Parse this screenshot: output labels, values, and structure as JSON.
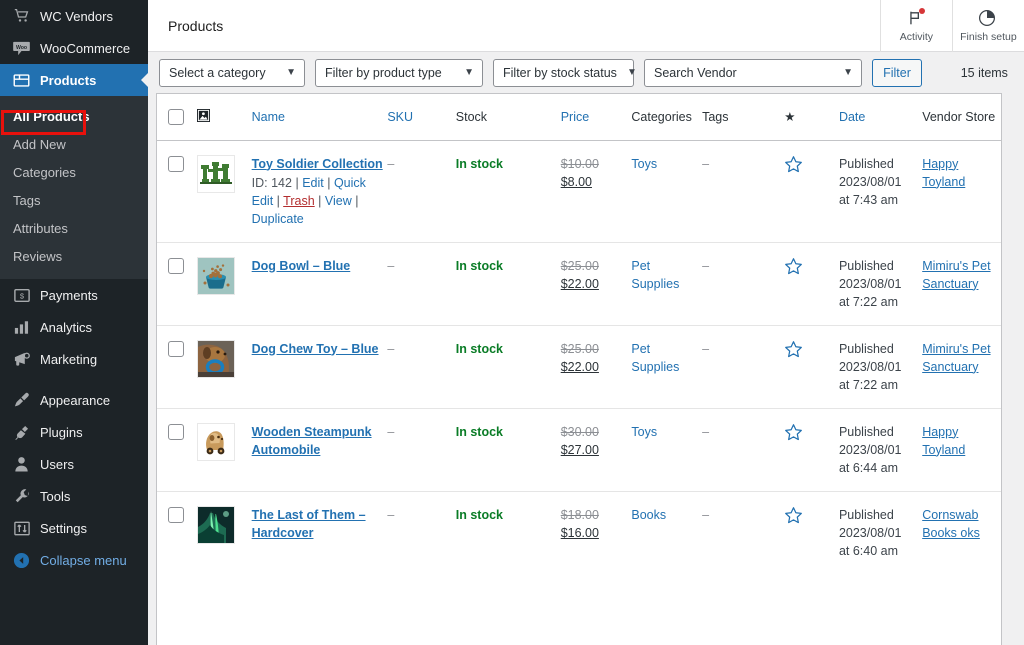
{
  "sidebar": {
    "items": [
      {
        "label": "WC Vendors",
        "icon": "cart-icon",
        "current": false
      },
      {
        "label": "WooCommerce",
        "icon": "woo-icon",
        "current": false
      },
      {
        "label": "Products",
        "icon": "products-box-icon",
        "current": true
      }
    ],
    "submenu": [
      {
        "label": "All Products",
        "active": true,
        "highlighted": true
      },
      {
        "label": "Add New",
        "active": false,
        "highlighted": false
      },
      {
        "label": "Categories",
        "active": false,
        "highlighted": false
      },
      {
        "label": "Tags",
        "active": false,
        "highlighted": false
      },
      {
        "label": "Attributes",
        "active": false,
        "highlighted": false
      },
      {
        "label": "Reviews",
        "active": false,
        "highlighted": false
      }
    ],
    "items_after": [
      {
        "label": "Payments",
        "icon": "payments-icon"
      },
      {
        "label": "Analytics",
        "icon": "bar-chart-icon"
      },
      {
        "label": "Marketing",
        "icon": "megaphone-icon"
      }
    ],
    "items_bottom": [
      {
        "label": "Appearance",
        "icon": "paintbrush-icon"
      },
      {
        "label": "Plugins",
        "icon": "plug-icon"
      },
      {
        "label": "Users",
        "icon": "user-icon"
      },
      {
        "label": "Tools",
        "icon": "wrench-icon"
      },
      {
        "label": "Settings",
        "icon": "sliders-icon"
      }
    ],
    "collapse": {
      "label": "Collapse menu",
      "icon": "collapse-arrow-icon"
    },
    "highlight_color": "#e8110c",
    "active_color": "#2271b1"
  },
  "topbar": {
    "title": "Products",
    "activity": {
      "label": "Activity",
      "icon": "flag-icon",
      "has_badge": true
    },
    "finish_setup": {
      "label": "Finish setup",
      "icon": "progress-circle-icon"
    }
  },
  "filters": {
    "category": "Select a category",
    "product_type": "Filter by product type",
    "stock_status": "Filter by stock status",
    "vendor": "Search Vendor",
    "filter_button": "Filter",
    "item_count": "15 items"
  },
  "table": {
    "columns": [
      {
        "key": "cb",
        "label": "",
        "link": false
      },
      {
        "key": "thumb",
        "label": "",
        "link": false
      },
      {
        "key": "name",
        "label": "Name",
        "link": true
      },
      {
        "key": "sku",
        "label": "SKU",
        "link": true
      },
      {
        "key": "stock",
        "label": "Stock",
        "link": false
      },
      {
        "key": "price",
        "label": "Price",
        "link": true
      },
      {
        "key": "categories",
        "label": "Categories",
        "link": false
      },
      {
        "key": "tags",
        "label": "Tags",
        "link": false
      },
      {
        "key": "featured",
        "label": "★",
        "link": false
      },
      {
        "key": "date",
        "label": "Date",
        "link": true
      },
      {
        "key": "vendor",
        "label": "Vendor Store",
        "link": false
      }
    ],
    "row_actions": {
      "id_prefix": "ID:",
      "edit": "Edit",
      "quick_edit": "Quick Edit",
      "trash": "Trash",
      "view": "View",
      "duplicate": "Duplicate"
    },
    "rows": [
      {
        "name": "Toy Soldier Collection",
        "id": "142",
        "show_actions": true,
        "thumb": "toy-soldiers-thumbnail",
        "sku": "–",
        "stock": "In stock",
        "price_old": "$10.00",
        "price_new": "$8.00",
        "categories": "Toys",
        "tags": "–",
        "featured": false,
        "date_status": "Published",
        "date_date": "2023/08/01",
        "date_time": "at 7:43 am",
        "vendor": "Happy Toyland"
      },
      {
        "name": "Dog Bowl – Blue",
        "id": "",
        "show_actions": false,
        "thumb": "dog-bowl-thumbnail",
        "sku": "–",
        "stock": "In stock",
        "price_old": "$25.00",
        "price_new": "$22.00",
        "categories": "Pet Supplies",
        "tags": "–",
        "featured": false,
        "date_status": "Published",
        "date_date": "2023/08/01",
        "date_time": "at 7:22 am",
        "vendor": "Mimiru's Pet Sanctuary"
      },
      {
        "name": "Dog Chew Toy – Blue",
        "id": "",
        "show_actions": false,
        "thumb": "dog-chew-toy-thumbnail",
        "sku": "–",
        "stock": "In stock",
        "price_old": "$25.00",
        "price_new": "$22.00",
        "categories": "Pet Supplies",
        "tags": "–",
        "featured": false,
        "date_status": "Published",
        "date_date": "2023/08/01",
        "date_time": "at 7:22 am",
        "vendor": "Mimiru's Pet Sanctuary"
      },
      {
        "name": "Wooden Steampunk Automobile",
        "id": "",
        "show_actions": false,
        "thumb": "wooden-car-thumbnail",
        "sku": "–",
        "stock": "In stock",
        "price_old": "$30.00",
        "price_new": "$27.00",
        "categories": "Toys",
        "tags": "–",
        "featured": false,
        "date_status": "Published",
        "date_date": "2023/08/01",
        "date_time": "at 6:44 am",
        "vendor": "Happy Toyland"
      },
      {
        "name": "The Last of Them – Hardcover",
        "id": "",
        "show_actions": false,
        "thumb": "book-cover-thumbnail",
        "sku": "–",
        "stock": "In stock",
        "price_old": "$18.00",
        "price_new": "$16.00",
        "categories": "Books",
        "tags": "–",
        "featured": false,
        "date_status": "Published",
        "date_date": "2023/08/01",
        "date_time": "at 6:40 am",
        "vendor": "Cornswab Books oks"
      }
    ]
  }
}
